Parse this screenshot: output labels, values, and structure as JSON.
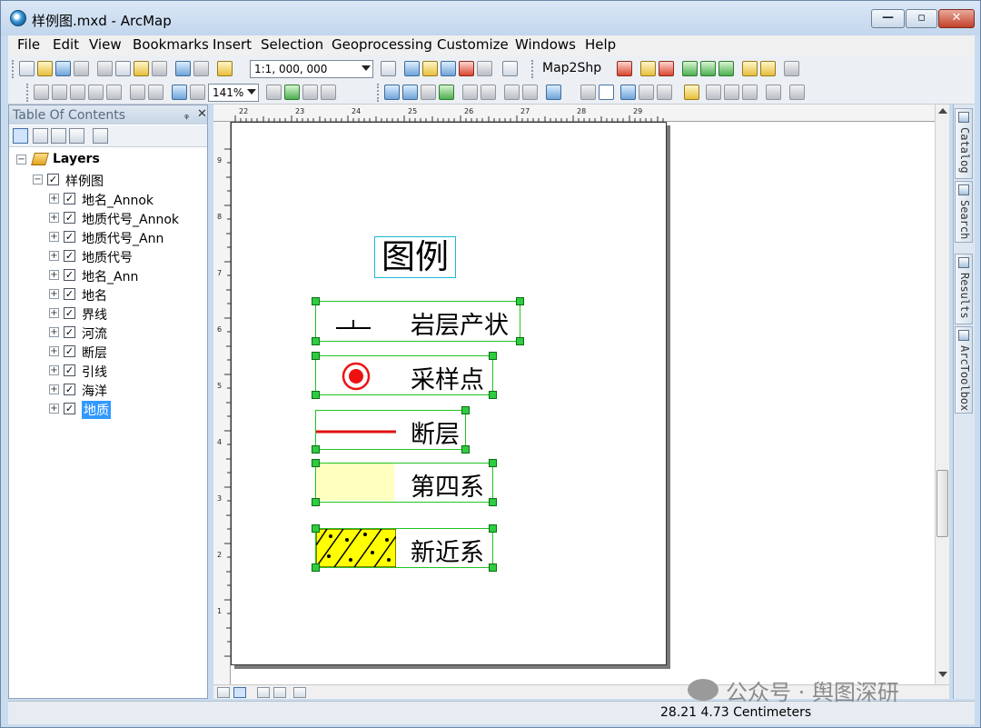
{
  "window": {
    "title": "样例图.mxd - ArcMap",
    "min_glyph": "—",
    "max_glyph": "▫",
    "close_glyph": "✕"
  },
  "menu": [
    "File",
    "Edit",
    "View",
    "Bookmarks",
    "Insert",
    "Selection",
    "Geoprocessing",
    "Customize",
    "Windows",
    "Help"
  ],
  "toolbar": {
    "scale_value": "1:1, 000, 000",
    "map2shp_label": "Map2Shp",
    "zoom_value": "141%"
  },
  "toc": {
    "title": "Table Of Contents",
    "pin_glyph": "ᵩ",
    "close_glyph": "✕",
    "root": "Layers",
    "dataframe": "样例图",
    "layers": [
      "地名_Annok",
      "地质代号_Annok",
      "地质代号_Ann",
      "地质代号",
      "地名_Ann",
      "地名",
      "界线",
      "河流",
      "断层",
      "引线",
      "海洋",
      "地质"
    ],
    "selected_layer": "地质"
  },
  "ruler": {
    "top": [
      "22",
      "23",
      "24",
      "25",
      "26",
      "27",
      "28",
      "29"
    ],
    "left": [
      "9",
      "8",
      "7",
      "6",
      "5",
      "4",
      "3",
      "2",
      "1"
    ]
  },
  "legend": {
    "title": "图例",
    "items": [
      "岩层产状",
      "采样点",
      "断层",
      "第四系",
      "新近系"
    ],
    "colors": {
      "selection": "#22c322",
      "fault_line": "#e01010",
      "sample_point": "#ee1111",
      "quaternary_fill": "#ffffc0",
      "neogene_fill": "#ffff00"
    }
  },
  "dock_tabs": [
    "Catalog",
    "Search",
    "Results",
    "ArcToolbox"
  ],
  "status": {
    "coords": "28.21  4.73 Centimeters"
  },
  "watermark": "公众号 · 舆图深研"
}
